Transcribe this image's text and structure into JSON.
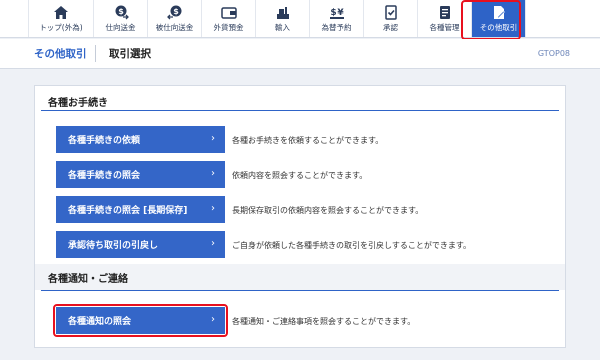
{
  "nav": {
    "items": [
      {
        "label": "トップ(外為)",
        "icon": "home-icon"
      },
      {
        "label": "仕向送金",
        "icon": "outgoing-remittance-icon"
      },
      {
        "label": "被仕向送金",
        "icon": "incoming-remittance-icon"
      },
      {
        "label": "外貨預金",
        "icon": "foreign-deposit-icon"
      },
      {
        "label": "輸入",
        "icon": "import-icon"
      },
      {
        "label": "為替予約",
        "icon": "exchange-contract-icon"
      },
      {
        "label": "承認",
        "icon": "approval-icon"
      },
      {
        "label": "各種管理",
        "icon": "management-icon"
      },
      {
        "label": "その他取引",
        "icon": "other-transactions-icon"
      }
    ],
    "active_index": 8
  },
  "breadcrumb": {
    "parent": "その他取引",
    "current": "取引選択"
  },
  "screen_id": "GTOP08",
  "sections": [
    {
      "title": "各種お手続き",
      "actions": [
        {
          "label": "各種手続きの依頼",
          "chevron": "›",
          "description": "各種お手続きを依頼することができます。"
        },
        {
          "label": "各種手続きの照会",
          "chevron": "›",
          "description": "依頼内容を照会することができます。"
        },
        {
          "label": "各種手続きの照会 [長期保存]",
          "chevron": "›",
          "description": "長期保存取引の依頼内容を照会することができます。"
        },
        {
          "label": "承認待ち取引の引戻し",
          "chevron": "›",
          "description": "ご自身が依頼した各種手続きの取引を引戻しすることができます。"
        }
      ]
    },
    {
      "title": "各種通知・ご連絡",
      "actions": [
        {
          "label": "各種通知の照会",
          "chevron": "›",
          "description": "各種通知・ご連絡事項を照会することができます。"
        }
      ]
    }
  ],
  "colors": {
    "accent": "#2e63c7",
    "button": "#3466c8",
    "highlight": "#e8101e"
  }
}
